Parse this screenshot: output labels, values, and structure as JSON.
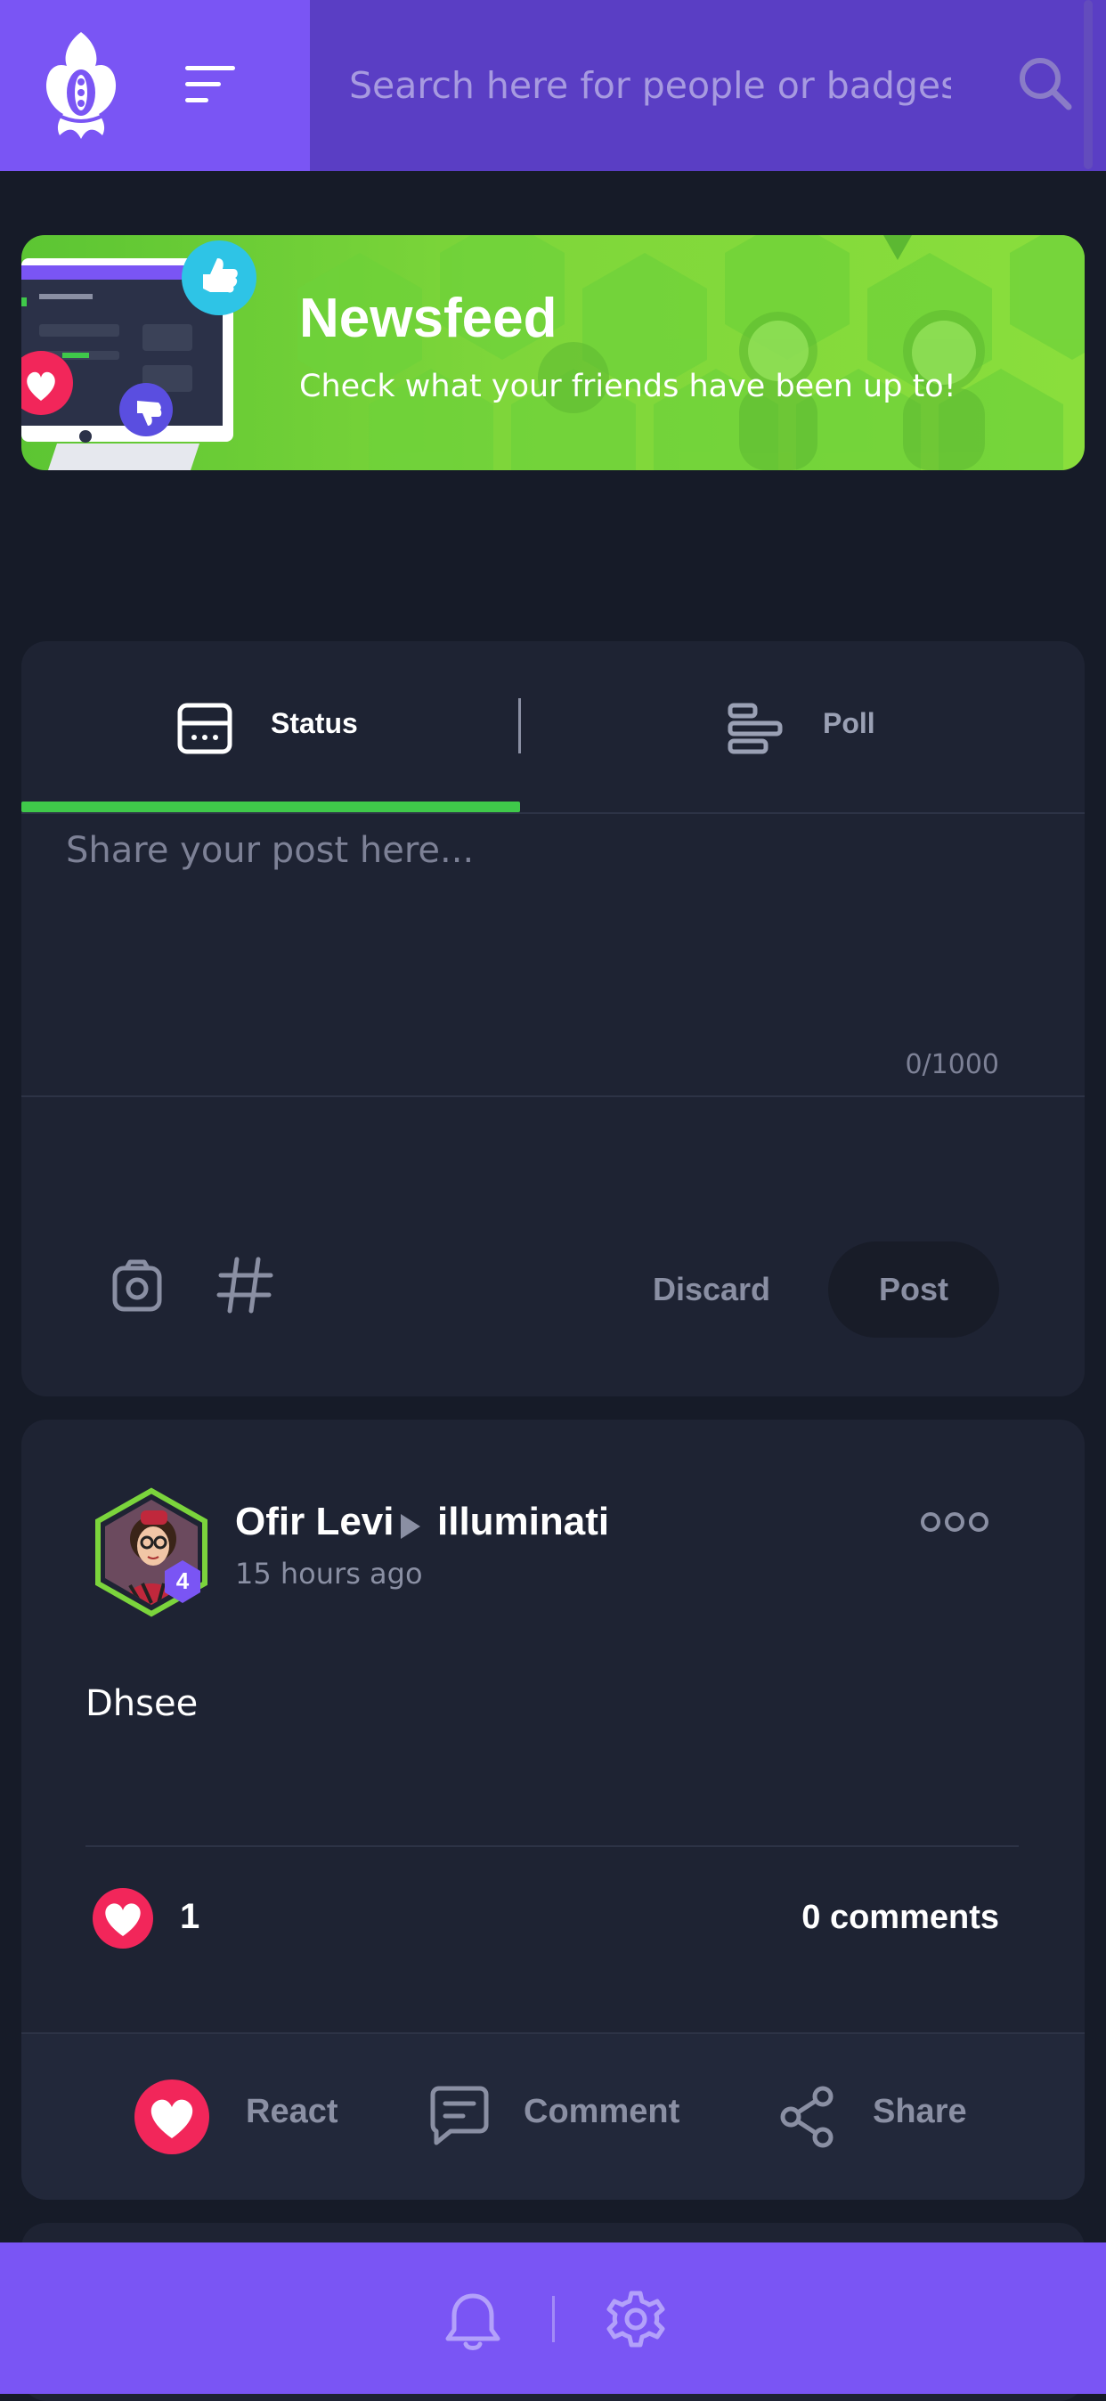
{
  "header": {
    "search_placeholder": "Search here for people or badges"
  },
  "banner": {
    "title": "Newsfeed",
    "subtitle": "Check what your friends have been up to!"
  },
  "composer": {
    "tabs": [
      {
        "label": "Status",
        "icon": "status-card-icon",
        "active": true
      },
      {
        "label": "Poll",
        "icon": "poll-bars-icon",
        "active": false
      }
    ],
    "placeholder": "Share your post here...",
    "char_count": "0/1000",
    "discard_label": "Discard",
    "post_label": "Post"
  },
  "post": {
    "author": "Ofir Levi",
    "group": "illuminati",
    "time": "15 hours ago",
    "level": "4",
    "text": "Dhsee",
    "reaction_count": "1",
    "comments": "0 comments",
    "actions": {
      "react": "React",
      "comment": "Comment",
      "share": "Share"
    }
  },
  "colors": {
    "background": "#161b28",
    "card": "#1e2333",
    "accent": "#7a55f4",
    "header": "#5a3ec4",
    "active_tab": "#3fc94a",
    "reaction": "#f2265a"
  }
}
